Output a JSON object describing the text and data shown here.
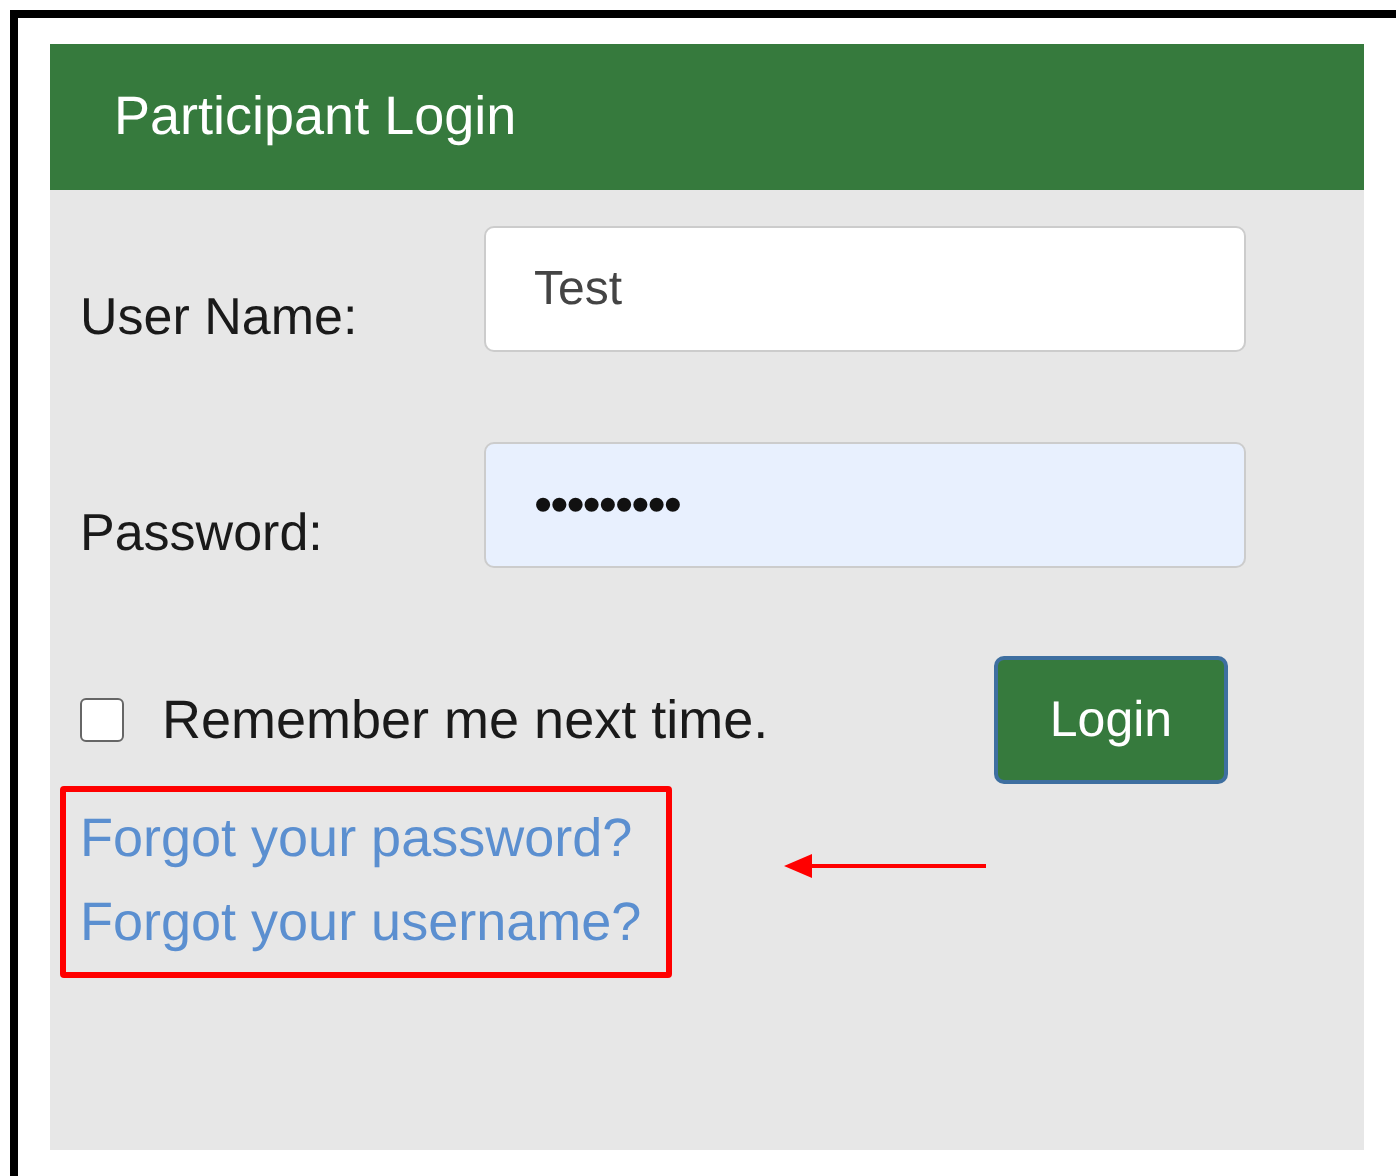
{
  "panel": {
    "title": "Participant Login"
  },
  "fields": [
    {
      "label": "User Name:",
      "value": "Test",
      "autofilled": false
    },
    {
      "label": "Password:",
      "value": "•••••••••",
      "autofilled": true
    }
  ],
  "remember": {
    "label": "Remember me next time.",
    "checked": false
  },
  "login_button": {
    "label": "Login"
  },
  "links": [
    "Forgot your password?",
    "Forgot your username?"
  ],
  "annotation": {
    "kind": "box-and-arrow"
  }
}
